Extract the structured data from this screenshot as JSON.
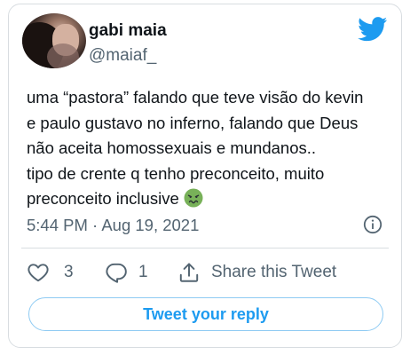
{
  "author": {
    "display_name": "gabi maia",
    "handle": "@maiaf_"
  },
  "tweet": {
    "lines": [
      "uma “pastora” falando que teve visão do kevin",
      "e paulo gustavo no inferno, falando que Deus",
      "não aceita homossexuais e mundanos..",
      "tipo de crente q tenho preconceito, muito",
      "preconceito inclusive"
    ],
    "emoji": "nauseated-face-emoji",
    "timestamp": "5:44 PM · Aug 19, 2021"
  },
  "actions": {
    "likes": "3",
    "replies": "1",
    "share_label": "Share this Tweet"
  },
  "reply_button": "Tweet your reply",
  "colors": {
    "accent": "#1d9bf0",
    "secondary_text": "#536471",
    "border": "#d8dde1"
  },
  "icons": [
    "twitter-bird-icon",
    "info-icon",
    "heart-icon",
    "reply-bubble-icon",
    "share-icon"
  ]
}
